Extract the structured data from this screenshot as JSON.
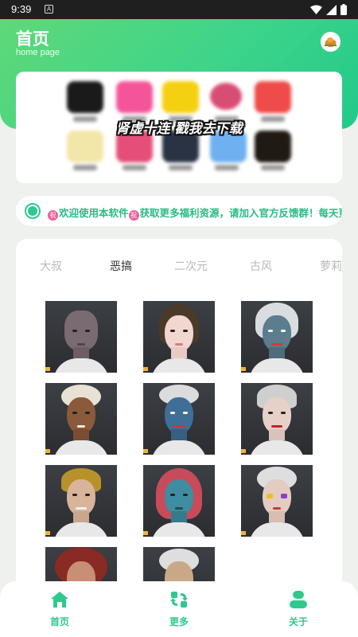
{
  "status": {
    "time": "9:39",
    "notif_letter": "A"
  },
  "header": {
    "title": "首页",
    "subtitle": "home page"
  },
  "banner": {
    "text": "肾虚十连 戳我去下载"
  },
  "notice": {
    "segment1": "欢迎使用本软件",
    "segment2": "获取更多福利资源，请加入官方反馈群！每天更",
    "badge": "祝"
  },
  "tabs": [
    "大叔",
    "恶搞",
    "二次元",
    "古风",
    "萝莉"
  ],
  "active_tab": "恶搞",
  "nav": [
    {
      "label": "首页",
      "icon": "home-icon"
    },
    {
      "label": "更多",
      "icon": "more-icon"
    },
    {
      "label": "关于",
      "icon": "user-icon"
    }
  ],
  "colors": {
    "accent": "#2fc98e",
    "header_start": "#5fd878",
    "header_end": "#22c98a"
  }
}
